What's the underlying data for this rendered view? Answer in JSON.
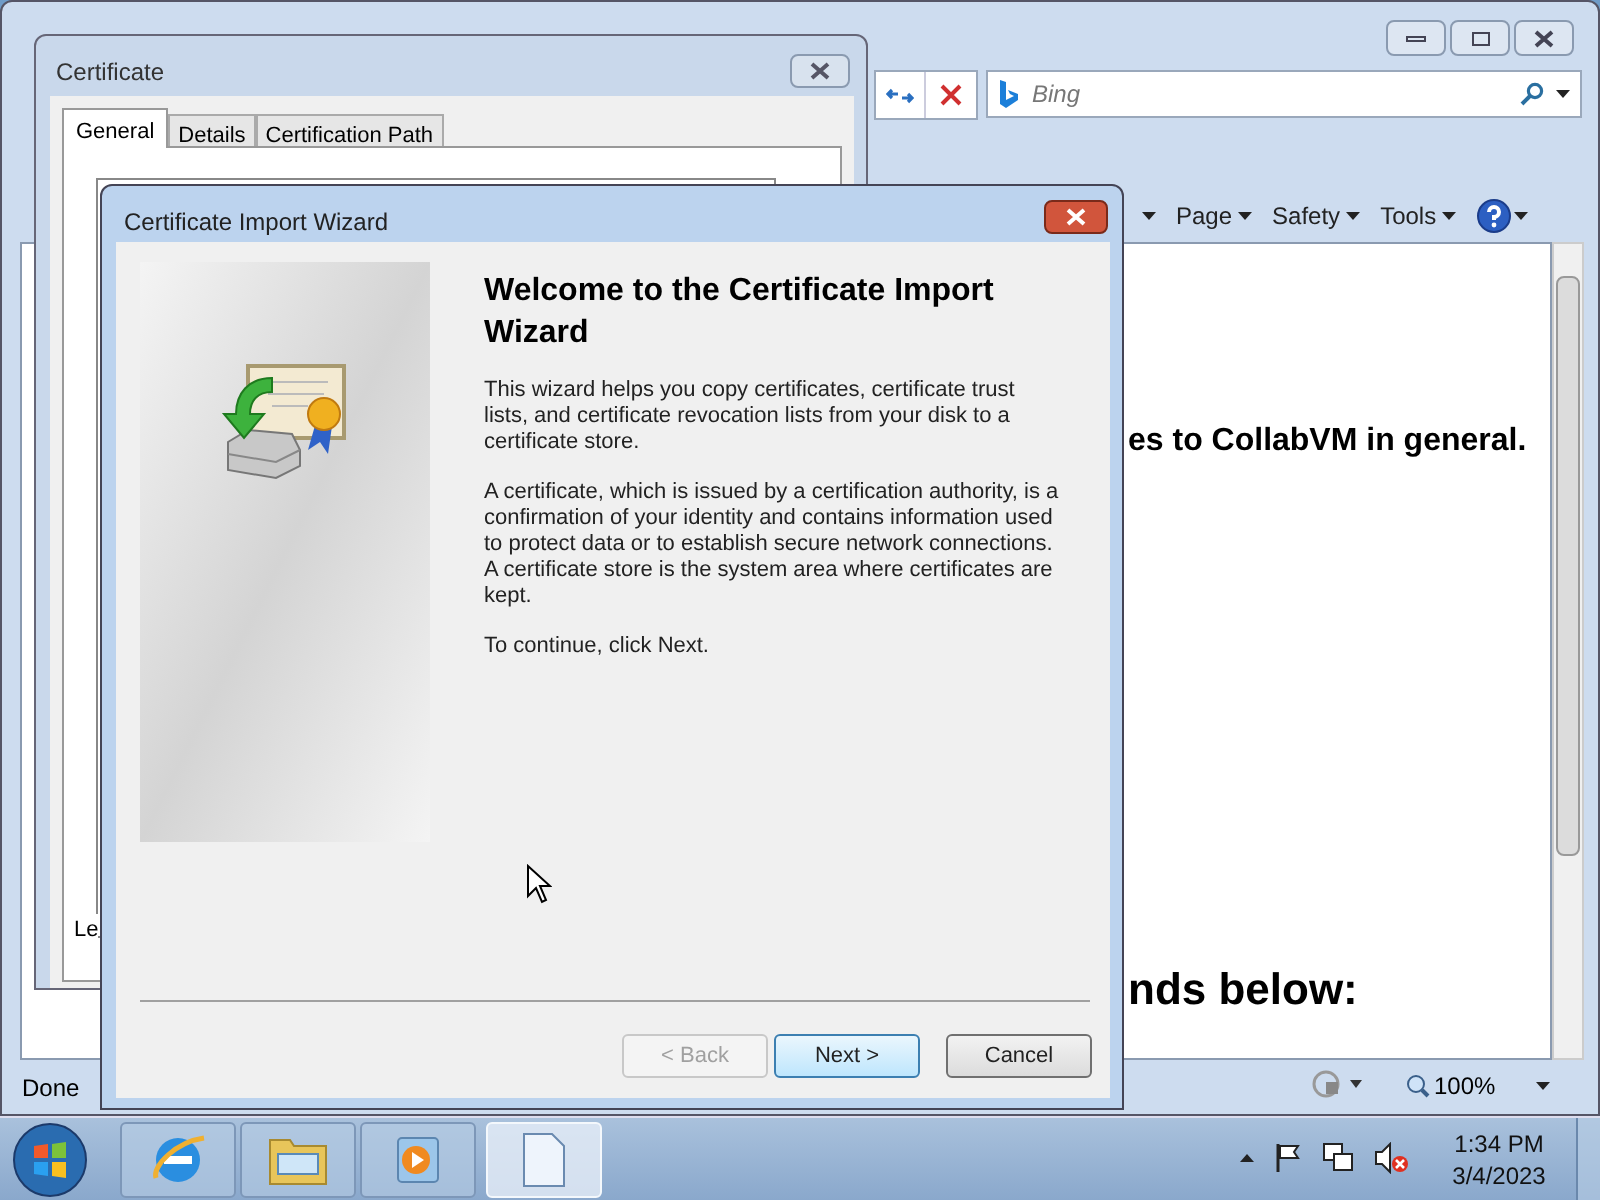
{
  "browser": {
    "search": {
      "placeholder": "Bing"
    },
    "command_bar": [
      {
        "label": "Page"
      },
      {
        "label": "Safety"
      },
      {
        "label": "Tools"
      }
    ],
    "content": [
      "es to CollabVM in general.",
      "nds below:"
    ],
    "status_bar": {
      "text": "Done",
      "zoom": "100%"
    }
  },
  "certificate_dialog": {
    "title": "Certificate",
    "tabs": [
      {
        "label": "General",
        "selected": true
      },
      {
        "label": "Details",
        "selected": false
      },
      {
        "label": "Certification Path",
        "selected": false
      }
    ],
    "partial_text": "Le"
  },
  "wizard": {
    "title": "Certificate Import Wizard",
    "heading": "Welcome to the Certificate Import Wizard",
    "paragraphs": [
      "This wizard helps you copy certificates, certificate trust lists, and certificate revocation lists from your disk to a certificate store.",
      "A certificate, which is issued by a certification authority, is a confirmation of your identity and contains information used to protect data or to establish secure network connections. A certificate store is the system area where certificates are kept.",
      "To continue, click Next."
    ],
    "buttons": [
      {
        "label": "< Back",
        "disabled": true,
        "default": false
      },
      {
        "label": "Next >",
        "disabled": false,
        "default": true
      },
      {
        "label": "Cancel",
        "disabled": false,
        "default": false
      }
    ]
  },
  "taskbar": {
    "items": [
      {
        "kind": "browser",
        "selected": false
      },
      {
        "kind": "folder",
        "selected": false
      },
      {
        "kind": "media",
        "selected": false
      },
      {
        "kind": "document",
        "selected": true
      }
    ],
    "clock": {
      "time": "1:34 PM",
      "date": "3/4/2023"
    }
  }
}
